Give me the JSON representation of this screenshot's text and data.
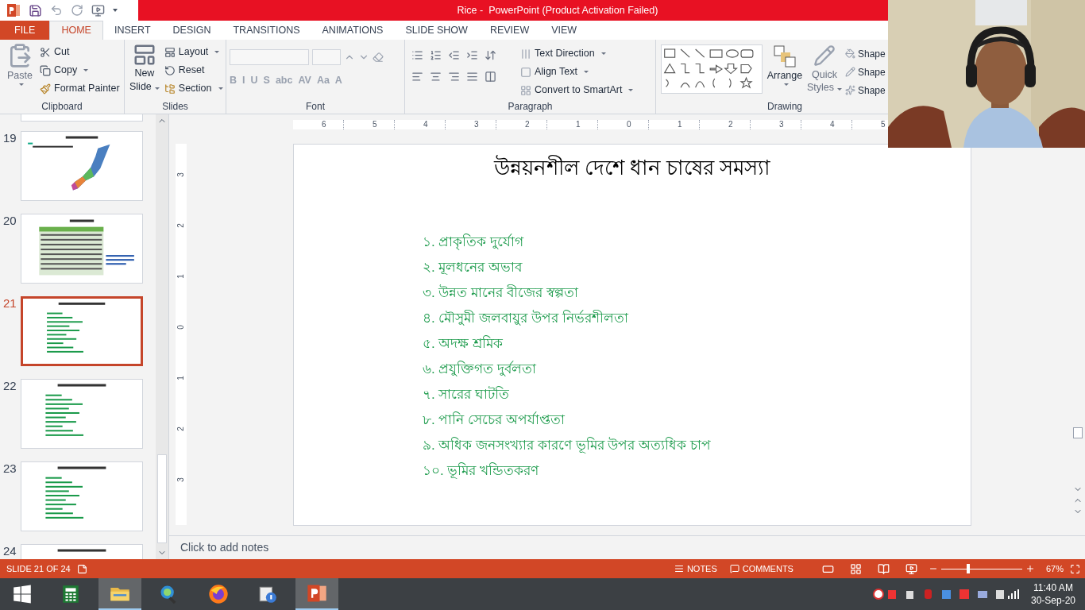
{
  "window": {
    "title": "Rice -  PowerPoint (Product Activation Failed)"
  },
  "tabs": [
    {
      "label": "FILE",
      "kind": "file",
      "selected": false
    },
    {
      "label": "HOME",
      "kind": "tab",
      "selected": true
    },
    {
      "label": "INSERT",
      "kind": "tab",
      "selected": false
    },
    {
      "label": "DESIGN",
      "kind": "tab",
      "selected": false
    },
    {
      "label": "TRANSITIONS",
      "kind": "tab",
      "selected": false
    },
    {
      "label": "ANIMATIONS",
      "kind": "tab",
      "selected": false
    },
    {
      "label": "SLIDE SHOW",
      "kind": "tab",
      "selected": false
    },
    {
      "label": "REVIEW",
      "kind": "tab",
      "selected": false
    },
    {
      "label": "VIEW",
      "kind": "tab",
      "selected": false
    }
  ],
  "ribbon": {
    "clipboard": {
      "label": "Clipboard",
      "paste": "Paste",
      "cut": "Cut",
      "copy": "Copy",
      "format_painter": "Format Painter"
    },
    "slides": {
      "label": "Slides",
      "new_slide": [
        "New",
        "Slide"
      ],
      "layout": "Layout",
      "reset": "Reset",
      "section": "Section"
    },
    "font": {
      "label": "Font",
      "buttons": [
        "B",
        "I",
        "U",
        "S",
        "abc",
        "AV",
        "Aa",
        "A"
      ]
    },
    "paragraph": {
      "label": "Paragraph",
      "text_direction": "Text Direction",
      "align_text": "Align Text",
      "convert": "Convert to SmartArt"
    },
    "drawing": {
      "label": "Drawing",
      "arrange": "Arrange",
      "quick_styles": [
        "Quick",
        "Styles"
      ],
      "shape_buttons": [
        "Shape",
        "Shape",
        "Shape"
      ]
    }
  },
  "thumbnails": [
    {
      "number": "19",
      "kind": "map",
      "selected": false
    },
    {
      "number": "20",
      "kind": "table",
      "selected": false
    },
    {
      "number": "21",
      "kind": "list",
      "selected": true
    },
    {
      "number": "22",
      "kind": "list",
      "selected": false
    },
    {
      "number": "23",
      "kind": "list",
      "selected": false
    },
    {
      "number": "24",
      "kind": "list",
      "selected": false
    }
  ],
  "ruler": {
    "horizontal": [
      "6",
      "5",
      "4",
      "3",
      "2",
      "1",
      "0",
      "1",
      "2",
      "3",
      "4",
      "5"
    ],
    "vertical": [
      "3",
      "2",
      "1",
      "0",
      "1",
      "2",
      "3"
    ]
  },
  "slide": {
    "title": "উন্নয়নশীল দেশে ধান চাষের সমস্যা",
    "items": [
      "১. প্রাকৃতিক দুর্যোগ",
      "২. মূলধনের অভাব",
      "৩. উন্নত মানের বীজের স্বল্পতা",
      "৪. মৌসুমী জলবায়ুর উপর নির্ভরশীলতা",
      "৫. অদক্ষ শ্রমিক",
      "৬. প্রযুক্তিগত দুর্বলতা",
      "৭. সারের ঘাটতি",
      "৮. পানি সেচের অপর্যাপ্ততা",
      "৯. অধিক জনসংখ্যার কারণে ভূমির উপর অত্যধিক চাপ",
      "১০. ভূমির খন্ডিতকরণ"
    ]
  },
  "notes": {
    "placeholder": "Click to add notes"
  },
  "status_bar": {
    "slide": "SLIDE 21 OF 24",
    "notes": "NOTES",
    "comments": "COMMENTS",
    "zoom": {
      "level": 0.33
    },
    "zoom_text": "67%"
  },
  "taskbar": {
    "apps": [
      {
        "kind": "calculator",
        "selected": false
      },
      {
        "kind": "folder",
        "selected": true
      },
      {
        "kind": "search",
        "selected": false
      },
      {
        "kind": "firefox",
        "selected": false
      },
      {
        "kind": "help",
        "selected": false
      },
      {
        "kind": "powerpoint",
        "selected": true
      }
    ],
    "time": "11:40 AM",
    "date": "30-Sep-20"
  }
}
